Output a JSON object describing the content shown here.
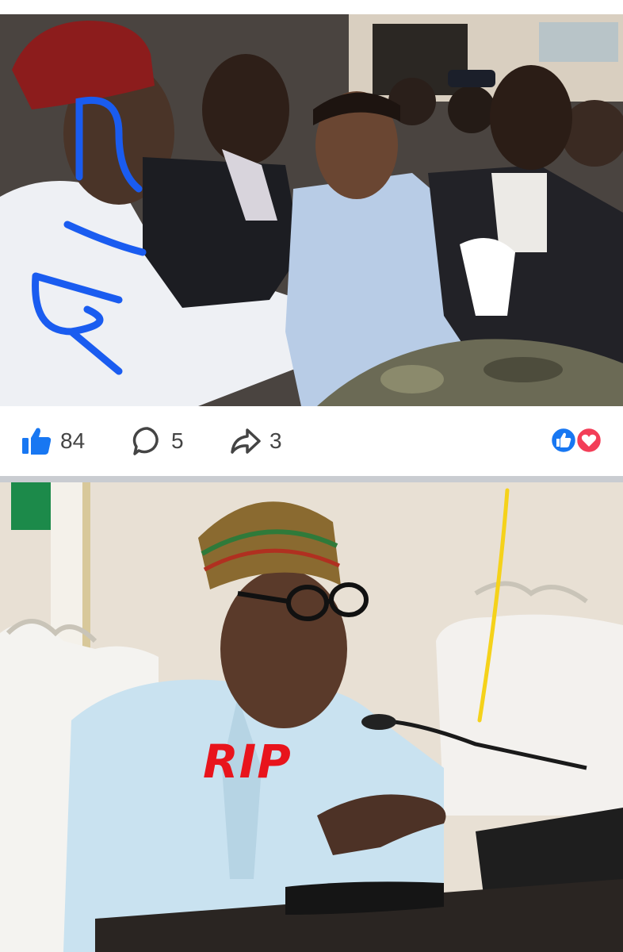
{
  "post": {
    "likes": "84",
    "comments": "5",
    "shares": "3"
  },
  "photo2": {
    "overlay_text": "RIP"
  },
  "colors": {
    "like_blue": "#1877f2",
    "love_red": "#f33e58",
    "rip_red": "#e8141c",
    "scribble_blue": "#1a5cf0",
    "scribble_yellow": "#f5d21a"
  },
  "icons": [
    "like-icon",
    "comment-icon",
    "share-icon",
    "like-reaction-icon",
    "love-reaction-icon"
  ]
}
